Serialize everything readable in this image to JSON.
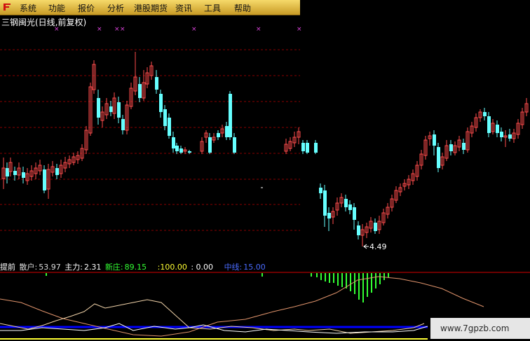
{
  "menu": [
    "系统",
    "功能",
    "报价",
    "分析",
    "港股期货",
    "资讯",
    "工具",
    "帮助"
  ],
  "title": "三钢闽光(日线,前复权)",
  "price_annotation": "4.49",
  "indicator": {
    "name": "提前",
    "sanhu_label": "散户:",
    "sanhu_value": "53.97",
    "zhuli_label": "主力:",
    "zhuli_value": "2.31",
    "xinzhuang_label": "新庄:",
    "xinzhuang_value": "89.15",
    "v100": ":100.00",
    "v0": ": 0.00",
    "zhongxian_label": "中线:",
    "zhongxian_value": "15.00"
  },
  "watermark": "www.7gpzb.com",
  "colors": {
    "up": "#ff4d4d",
    "down": "#66ffff",
    "grid": "#8a0000",
    "divider": "#d80000",
    "green": "#33ff33",
    "blue": "#0000ff",
    "white": "#ffffff",
    "wheat": "#f0d2a8",
    "salmon": "#e0946c",
    "sanhu": "#dcdcdc",
    "zhuli": "#ffffff",
    "xinzhuang": "#33ff33",
    "v100": "#ffff33",
    "zhongxian": "#4a6bff",
    "marker": "#dd44dd"
  }
}
